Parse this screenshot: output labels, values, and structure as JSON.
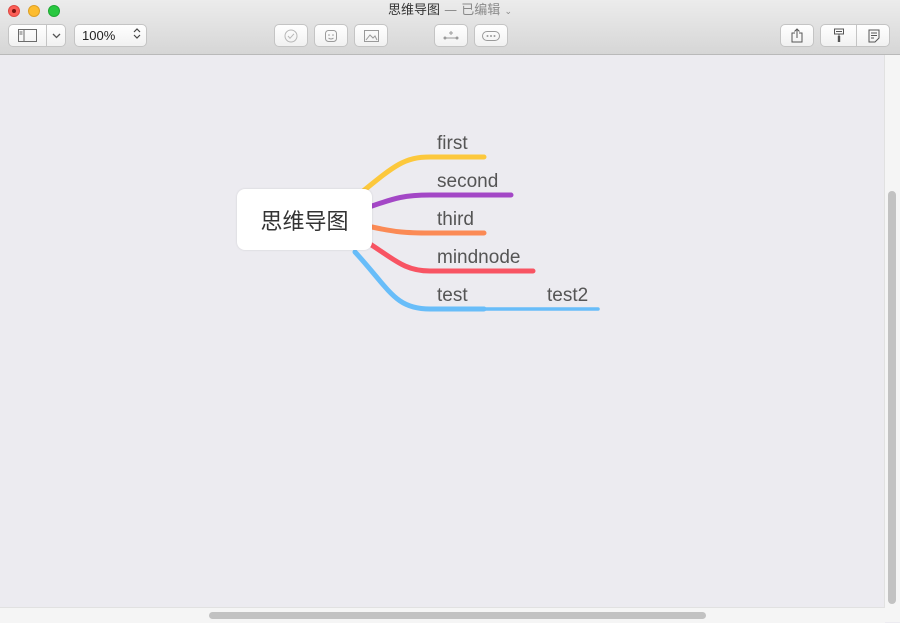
{
  "window": {
    "title": "思维导图",
    "title_suffix": "— 已编辑",
    "title_chevron": "⌄"
  },
  "toolbar": {
    "zoom_value": "100%",
    "zoom_stepper": "▲▼"
  },
  "mindmap": {
    "central_topic": "思维导图",
    "branches": [
      {
        "label": "first",
        "color": "#fcc83c"
      },
      {
        "label": "second",
        "color": "#a347c6"
      },
      {
        "label": "third",
        "color": "#fb8a55"
      },
      {
        "label": "mindnode",
        "color": "#f85463"
      },
      {
        "label": "test",
        "color": "#68bdf9",
        "children": [
          {
            "label": "test2",
            "color": "#68bdf9"
          }
        ]
      }
    ]
  },
  "icons": {
    "sidebar": "sidebar-icon",
    "dropdown": "chevron-down-icon",
    "task": "checkmark-icon",
    "sticker": "sticker-icon",
    "image": "image-icon",
    "add_node": "add-child-icon",
    "more": "more-icon",
    "share": "share-icon",
    "format": "format-brush-icon",
    "notes": "notes-icon"
  }
}
